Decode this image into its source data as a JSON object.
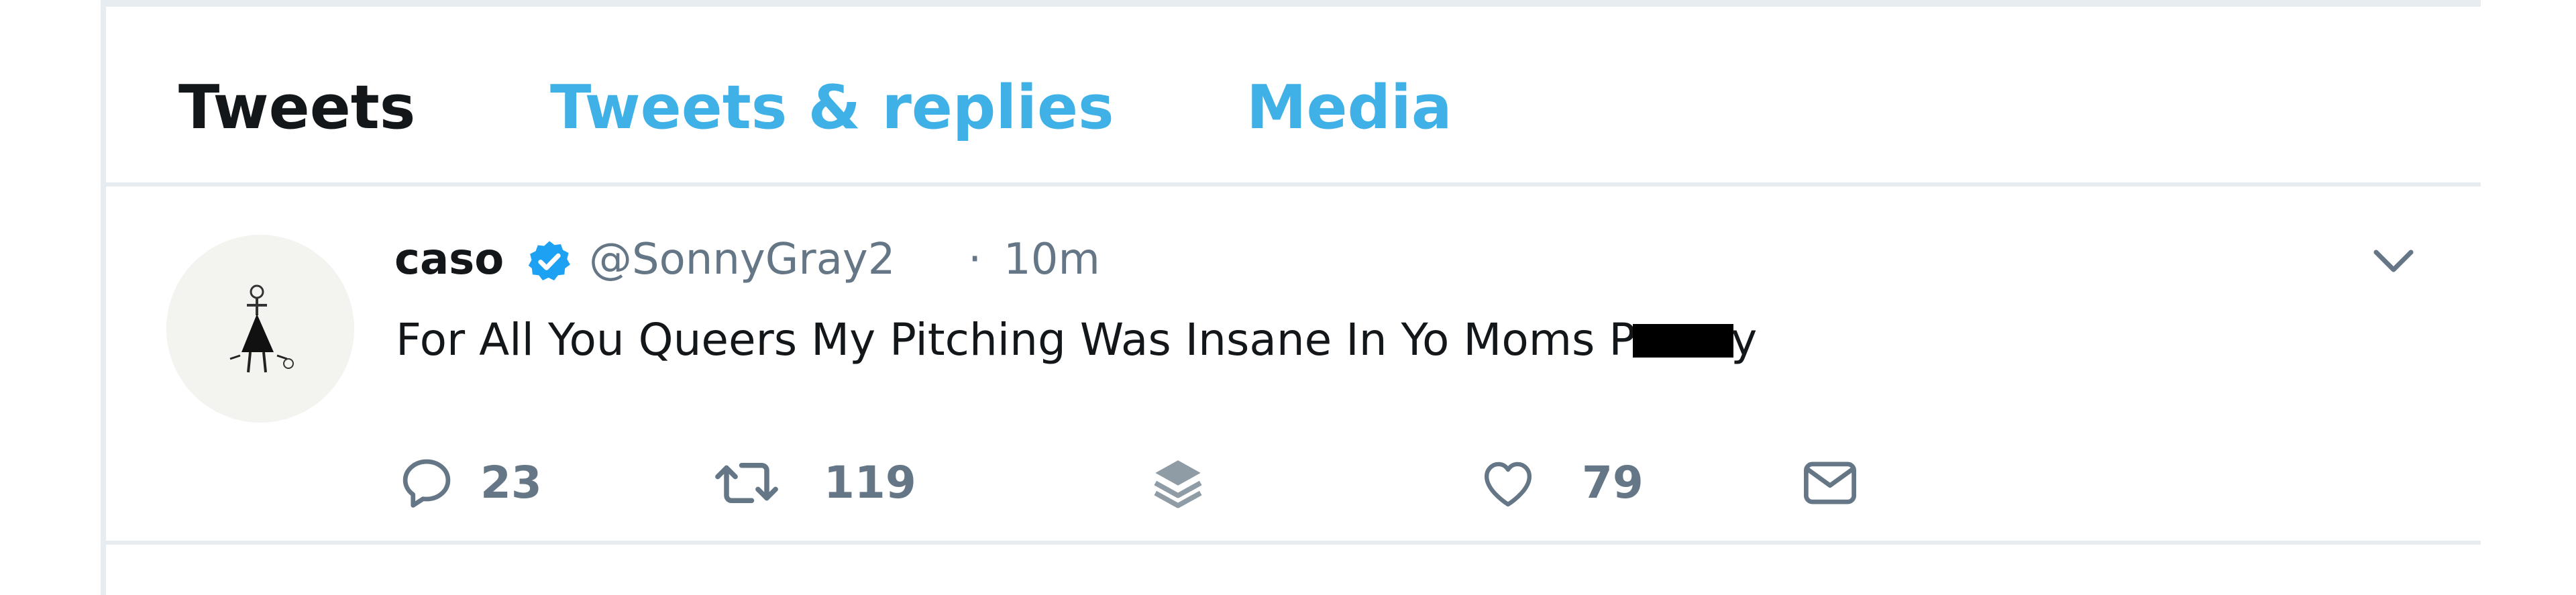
{
  "tabs": [
    {
      "label": "Tweets",
      "active": true
    },
    {
      "label": "Tweets & replies",
      "active": false
    },
    {
      "label": "Media",
      "active": false
    }
  ],
  "tweet": {
    "display_name": "caso",
    "verified": true,
    "handle": "@SonnyGray2",
    "separator": "·",
    "time": "10m",
    "text_before": "For All You Queers My Pitching Was Insane In Yo Moms P",
    "text_after": "y",
    "actions": {
      "reply": {
        "icon": "reply-icon",
        "count": "23"
      },
      "retweet": {
        "icon": "retweet-icon",
        "count": "119"
      },
      "stack": {
        "icon": "layers-icon"
      },
      "like": {
        "icon": "heart-icon",
        "count": "79"
      },
      "message": {
        "icon": "envelope-icon"
      }
    }
  },
  "colors": {
    "accent": "#3fb1e6",
    "text": "#14171a",
    "muted": "#657786",
    "verified": "#1da1f2"
  }
}
